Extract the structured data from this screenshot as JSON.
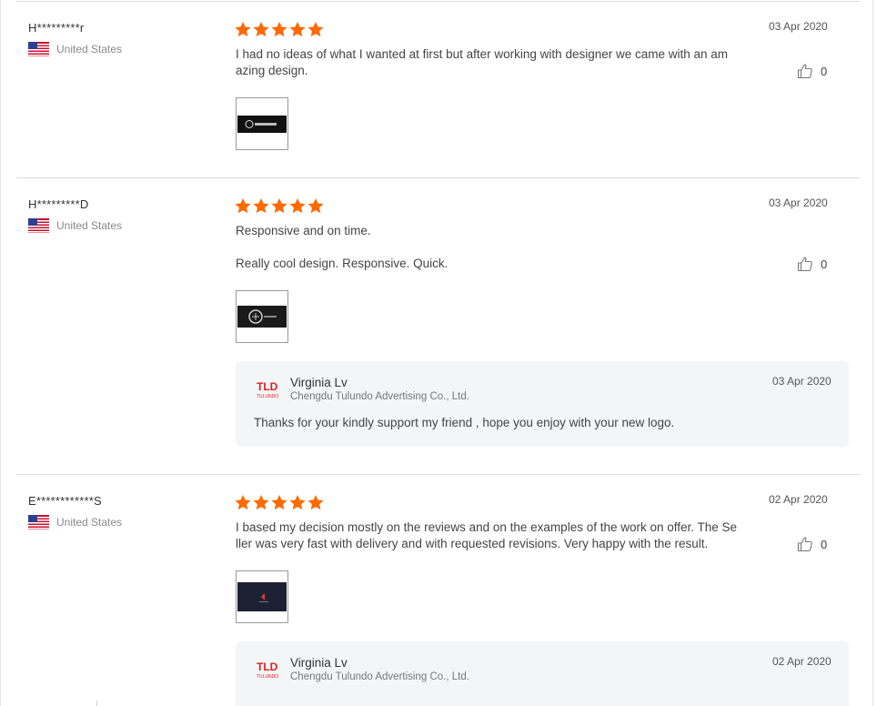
{
  "colors": {
    "star": "#ff6a00",
    "divider": "#dcdcdc",
    "reply_bg": "#f4f5f7"
  },
  "reviews": [
    {
      "buyer": "H*********r",
      "country": "United States",
      "flag_icon": "us-flag-icon",
      "rating": 5,
      "date": "03 Apr 2020",
      "text_lines": [
        "I had no ideas of what I wanted at first but after working with designer we came with an am",
        "azing design."
      ],
      "likes": "0",
      "thumb_color": "#111111"
    },
    {
      "buyer": "H*********D",
      "country": "United States",
      "flag_icon": "us-flag-icon",
      "rating": 5,
      "date": "03 Apr 2020",
      "text_lines": [
        "Responsive and on time."
      ],
      "text2": "Really cool design. Responsive. Quick.",
      "likes": "0",
      "thumb_color": "#1a1a1a",
      "reply": {
        "seller": "Virginia Lv",
        "company": "Chengdu Tulundo Advertising Co., Ltd.",
        "date": "03 Apr 2020",
        "text": "Thanks for your kindly support my friend , hope you enjoy  with your new logo."
      }
    },
    {
      "buyer": "E************S",
      "country": "United States",
      "flag_icon": "us-flag-icon",
      "rating": 5,
      "date": "02 Apr 2020",
      "text_lines": [
        "I based my decision mostly on the reviews and on the examples of the work on offer. The Se",
        "ller was very fast with delivery and with requested revisions. Very happy with the result."
      ],
      "likes": "0",
      "thumb_color": "#1c2233",
      "reply": {
        "seller": "Virginia Lv",
        "company": "Chengdu Tulundo Advertising Co., Ltd.",
        "date": "02 Apr 2020",
        "text": ""
      }
    }
  ]
}
